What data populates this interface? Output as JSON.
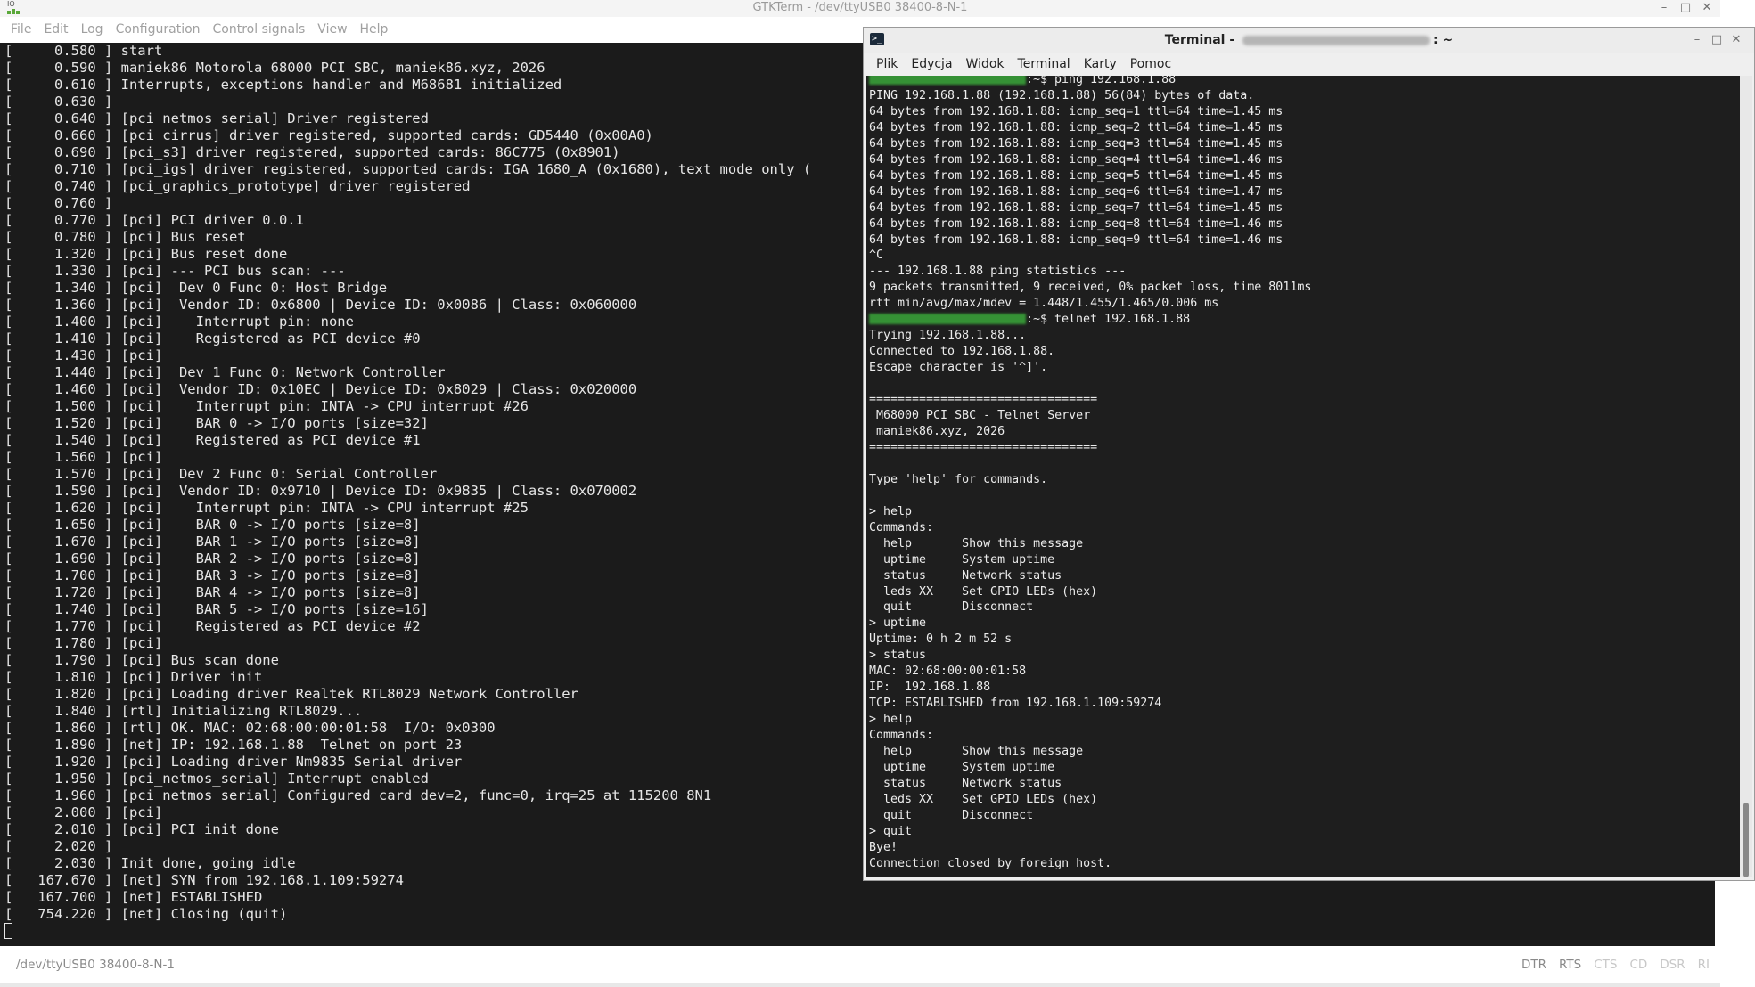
{
  "gtkterm": {
    "title": "GTKTerm - /dev/ttyUSB0  38400-8-N-1",
    "app_icon_text": "IO",
    "menu": [
      "File",
      "Edit",
      "Log",
      "Configuration",
      "Control signals",
      "View",
      "Help"
    ],
    "lines": [
      "[     0.580 ] start",
      "[     0.590 ] maniek86 Motorola 68000 PCI SBC, maniek86.xyz, 2026",
      "[     0.610 ] Interrupts, exceptions handler and M68681 initialized",
      "[     0.630 ]",
      "[     0.640 ] [pci_netmos_serial] Driver registered",
      "[     0.660 ] [pci_cirrus] driver registered, supported cards: GD5440 (0x00A0)",
      "[     0.690 ] [pci_s3] driver registered, supported cards: 86C775 (0x8901)",
      "[     0.710 ] [pci_igs] driver registered, supported cards: IGA 1680_A (0x1680), text mode only (",
      "[     0.740 ] [pci_graphics_prototype] driver registered",
      "[     0.760 ]",
      "[     0.770 ] [pci] PCI driver 0.0.1",
      "[     0.780 ] [pci] Bus reset",
      "[     1.320 ] [pci] Bus reset done",
      "[     1.330 ] [pci] --- PCI bus scan: ---",
      "[     1.340 ] [pci]  Dev 0 Func 0: Host Bridge",
      "[     1.360 ] [pci]  Vendor ID: 0x6800 | Device ID: 0x0086 | Class: 0x060000",
      "[     1.400 ] [pci]    Interrupt pin: none",
      "[     1.410 ] [pci]    Registered as PCI device #0",
      "[     1.430 ] [pci]",
      "[     1.440 ] [pci]  Dev 1 Func 0: Network Controller",
      "[     1.460 ] [pci]  Vendor ID: 0x10EC | Device ID: 0x8029 | Class: 0x020000",
      "[     1.500 ] [pci]    Interrupt pin: INTA -> CPU interrupt #26",
      "[     1.520 ] [pci]    BAR 0 -> I/O ports [size=32]",
      "[     1.540 ] [pci]    Registered as PCI device #1",
      "[     1.560 ] [pci]",
      "[     1.570 ] [pci]  Dev 2 Func 0: Serial Controller",
      "[     1.590 ] [pci]  Vendor ID: 0x9710 | Device ID: 0x9835 | Class: 0x070002",
      "[     1.620 ] [pci]    Interrupt pin: INTA -> CPU interrupt #25",
      "[     1.650 ] [pci]    BAR 0 -> I/O ports [size=8]",
      "[     1.670 ] [pci]    BAR 1 -> I/O ports [size=8]",
      "[     1.690 ] [pci]    BAR 2 -> I/O ports [size=8]",
      "[     1.700 ] [pci]    BAR 3 -> I/O ports [size=8]",
      "[     1.720 ] [pci]    BAR 4 -> I/O ports [size=8]",
      "[     1.740 ] [pci]    BAR 5 -> I/O ports [size=16]",
      "[     1.770 ] [pci]    Registered as PCI device #2",
      "[     1.780 ] [pci]",
      "[     1.790 ] [pci] Bus scan done",
      "[     1.810 ] [pci] Driver init",
      "[     1.820 ] [pci] Loading driver Realtek RTL8029 Network Controller",
      "[     1.840 ] [rtl] Initializing RTL8029...",
      "[     1.860 ] [rtl] OK. MAC: 02:68:00:00:01:58  I/O: 0x0300",
      "[     1.890 ] [net] IP: 192.168.1.88  Telnet on port 23",
      "[     1.920 ] [pci] Loading driver Nm9835 Serial driver",
      "[     1.950 ] [pci_netmos_serial] Interrupt enabled",
      "[     1.960 ] [pci_netmos_serial] Configured card dev=2, func=0, irq=25 at 115200 8N1",
      "[     2.000 ] [pci]",
      "[     2.010 ] [pci] PCI init done",
      "[     2.020 ]",
      "[     2.030 ] Init done, going idle",
      "[   167.670 ] [net] SYN from 192.168.1.109:59274",
      "[   167.700 ] [net] ESTABLISHED",
      "[   754.220 ] [net] Closing (quit)"
    ],
    "status_port": "/dev/ttyUSB0  38400-8-N-1",
    "signals": [
      {
        "label": "DTR",
        "active": true
      },
      {
        "label": "RTS",
        "active": true
      },
      {
        "label": "CTS",
        "active": false
      },
      {
        "label": "CD",
        "active": false
      },
      {
        "label": "DSR",
        "active": false
      },
      {
        "label": "RI",
        "active": false
      }
    ]
  },
  "terminal": {
    "title_prefix": "Terminal - ",
    "title_suffix": ": ~",
    "menu": [
      "Plik",
      "Edycja",
      "Widok",
      "Terminal",
      "Karty",
      "Pomoc"
    ],
    "lines": [
      {
        "prompt": true,
        "text": ":~$ ping 192.168.1.88"
      },
      {
        "text": "PING 192.168.1.88 (192.168.1.88) 56(84) bytes of data."
      },
      {
        "text": "64 bytes from 192.168.1.88: icmp_seq=1 ttl=64 time=1.45 ms"
      },
      {
        "text": "64 bytes from 192.168.1.88: icmp_seq=2 ttl=64 time=1.45 ms"
      },
      {
        "text": "64 bytes from 192.168.1.88: icmp_seq=3 ttl=64 time=1.45 ms"
      },
      {
        "text": "64 bytes from 192.168.1.88: icmp_seq=4 ttl=64 time=1.46 ms"
      },
      {
        "text": "64 bytes from 192.168.1.88: icmp_seq=5 ttl=64 time=1.45 ms"
      },
      {
        "text": "64 bytes from 192.168.1.88: icmp_seq=6 ttl=64 time=1.47 ms"
      },
      {
        "text": "64 bytes from 192.168.1.88: icmp_seq=7 ttl=64 time=1.45 ms"
      },
      {
        "text": "64 bytes from 192.168.1.88: icmp_seq=8 ttl=64 time=1.46 ms"
      },
      {
        "text": "64 bytes from 192.168.1.88: icmp_seq=9 ttl=64 time=1.46 ms"
      },
      {
        "text": "^C"
      },
      {
        "text": "--- 192.168.1.88 ping statistics ---"
      },
      {
        "text": "9 packets transmitted, 9 received, 0% packet loss, time 8011ms"
      },
      {
        "text": "rtt min/avg/max/mdev = 1.448/1.455/1.465/0.006 ms"
      },
      {
        "prompt": true,
        "text": ":~$ telnet 192.168.1.88"
      },
      {
        "text": "Trying 192.168.1.88..."
      },
      {
        "text": "Connected to 192.168.1.88."
      },
      {
        "text": "Escape character is '^]'."
      },
      {
        "text": ""
      },
      {
        "text": "================================"
      },
      {
        "text": " M68000 PCI SBC - Telnet Server"
      },
      {
        "text": " maniek86.xyz, 2026"
      },
      {
        "text": "================================"
      },
      {
        "text": ""
      },
      {
        "text": "Type 'help' for commands."
      },
      {
        "text": ""
      },
      {
        "text": "> help"
      },
      {
        "text": "Commands:"
      },
      {
        "text": "  help       Show this message"
      },
      {
        "text": "  uptime     System uptime"
      },
      {
        "text": "  status     Network status"
      },
      {
        "text": "  leds XX    Set GPIO LEDs (hex)"
      },
      {
        "text": "  quit       Disconnect"
      },
      {
        "text": "> uptime"
      },
      {
        "text": "Uptime: 0 h 2 m 52 s"
      },
      {
        "text": "> status"
      },
      {
        "text": "MAC: 02:68:00:00:01:58"
      },
      {
        "text": "IP:  192.168.1.88"
      },
      {
        "text": "TCP: ESTABLISHED from 192.168.1.109:59274"
      },
      {
        "text": "> help"
      },
      {
        "text": "Commands:"
      },
      {
        "text": "  help       Show this message"
      },
      {
        "text": "  uptime     System uptime"
      },
      {
        "text": "  status     Network status"
      },
      {
        "text": "  leds XX    Set GPIO LEDs (hex)"
      },
      {
        "text": "  quit       Disconnect"
      },
      {
        "text": "> quit"
      },
      {
        "text": "Bye!"
      },
      {
        "text": "Connection closed by foreign host."
      }
    ]
  },
  "icons": {
    "minimize": "minimize-icon",
    "maximize": "maximize-icon",
    "close": "close-icon",
    "terminal_app": "terminal-app-icon"
  }
}
